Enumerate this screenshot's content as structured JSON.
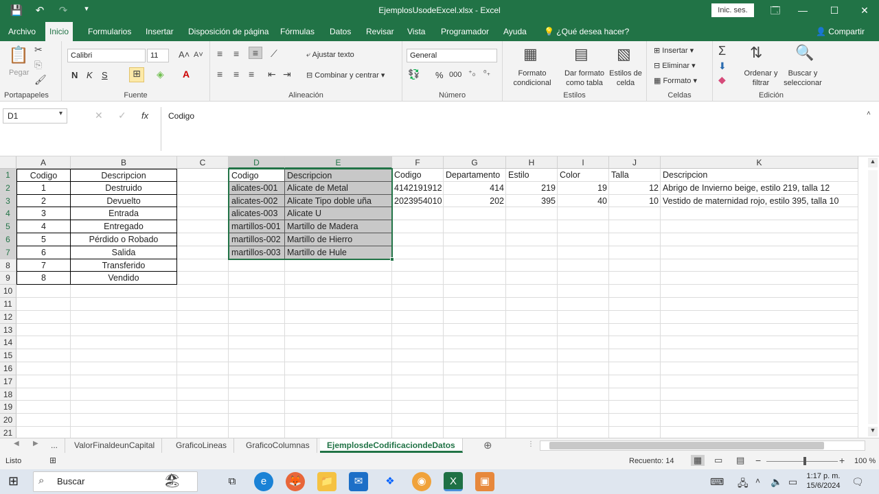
{
  "window": {
    "title": "EjemplosUsodeExcel.xlsx  -  Excel",
    "signin": "Inic. ses.",
    "controls": [
      "🗔",
      "—",
      "☐",
      "✕"
    ]
  },
  "qat": {
    "save": "💾",
    "undo": "↶",
    "redo": "↷",
    "customize": "▾"
  },
  "tabs": [
    "Archivo",
    "Inicio",
    "Formularios",
    "Insertar",
    "Disposición de página",
    "Fórmulas",
    "Datos",
    "Revisar",
    "Vista",
    "Programador",
    "Ayuda"
  ],
  "tell_me": "¿Qué desea hacer?",
  "share": "Compartir",
  "ribbon": {
    "clipboard": {
      "label": "Portapapeles",
      "paste": "Pegar"
    },
    "font": {
      "label": "Fuente",
      "name": "Calibri",
      "size": "11",
      "bold": "N",
      "italic": "K",
      "underline": "S"
    },
    "alignment": {
      "label": "Alineación",
      "wrap": "Ajustar texto",
      "merge": "Combinar y centrar"
    },
    "number": {
      "label": "Número",
      "format": "General",
      "percent": "%",
      "thousands": "000"
    },
    "styles": {
      "label": "Estilos",
      "conditional": "Formato condicional",
      "as_table": "Dar formato como tabla",
      "cell_styles": "Estilos de celda"
    },
    "cells": {
      "label": "Celdas",
      "insert": "Insertar",
      "delete": "Eliminar",
      "format": "Formato"
    },
    "editing": {
      "label": "Edición",
      "sort": "Ordenar y filtrar",
      "find": "Buscar y seleccionar"
    }
  },
  "formula_bar": {
    "name_box": "D1",
    "fx": "fx",
    "content": "Codigo"
  },
  "columns": [
    "A",
    "B",
    "C",
    "D",
    "E",
    "F",
    "G",
    "H",
    "I",
    "J",
    "K"
  ],
  "rows": [
    "1",
    "2",
    "3",
    "4",
    "5",
    "6",
    "7",
    "8",
    "9",
    "10",
    "11",
    "12",
    "13",
    "14",
    "15",
    "16",
    "17",
    "18",
    "19",
    "20",
    "21"
  ],
  "table_ab": {
    "headers": [
      "Codigo",
      "Descripcion"
    ],
    "rows": [
      [
        "1",
        "Destruido"
      ],
      [
        "2",
        "Devuelto"
      ],
      [
        "3",
        "Entrada"
      ],
      [
        "4",
        "Entregado"
      ],
      [
        "5",
        "Pérdido o Robado"
      ],
      [
        "6",
        "Salida"
      ],
      [
        "7",
        "Transferido"
      ],
      [
        "8",
        "Vendido"
      ]
    ]
  },
  "table_de": {
    "headers": [
      "Codigo",
      "Descripcion"
    ],
    "rows": [
      [
        "alicates-001",
        "Alicate de Metal"
      ],
      [
        "alicates-002",
        "Alicate Tipo doble uña"
      ],
      [
        "alicates-003",
        "Alicate U"
      ],
      [
        "martillos-001",
        "Martillo de Madera"
      ],
      [
        "martillos-002",
        "Martillo de Hierro"
      ],
      [
        "martillos-003",
        "Martillo de Hule"
      ]
    ]
  },
  "table_fk": {
    "headers": [
      "Codigo",
      "Departamento",
      "Estilo",
      "Color",
      "Talla",
      "Descripcion"
    ],
    "rows": [
      [
        "4142191912",
        "414",
        "219",
        "19",
        "12",
        "Abrigo de Invierno beige, estilo 219, talla 12"
      ],
      [
        "2023954010",
        "202",
        "395",
        "40",
        "10",
        "Vestido de maternidad rojo, estilo 395, talla 10"
      ]
    ]
  },
  "sheets": [
    "...",
    "ValorFinaldeunCapital",
    "GraficoLineas",
    "GraficoColumnas",
    "EjemplosdeCodificaciondeDatos"
  ],
  "status": {
    "ready": "Listo",
    "count": "Recuento: 14",
    "zoom": "100 %"
  },
  "taskbar": {
    "search": "Buscar",
    "time": "1:17 p. m.",
    "date": "15/6/2024"
  },
  "colors": {
    "accent": "#217346",
    "selection": "#c8c8c8"
  }
}
